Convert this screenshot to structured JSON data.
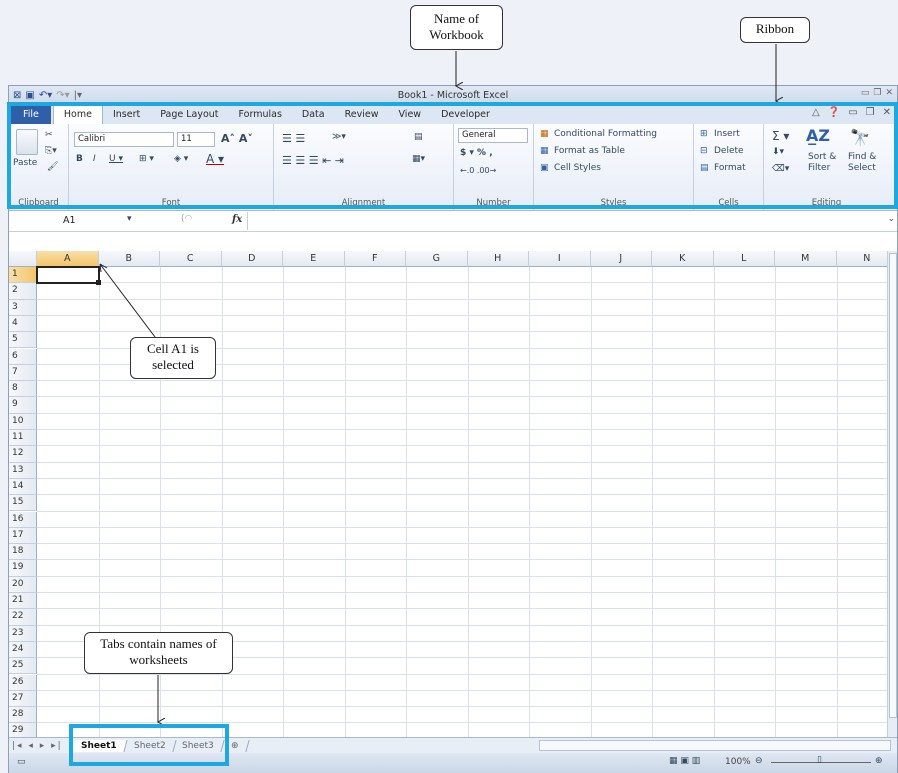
{
  "window": {
    "title": "Book1  -  Microsoft Excel"
  },
  "tabs": [
    "File",
    "Home",
    "Insert",
    "Page Layout",
    "Formulas",
    "Data",
    "Review",
    "View",
    "Developer"
  ],
  "ribbon": {
    "clipboard": {
      "label": "Clipboard",
      "paste": "Paste"
    },
    "font": {
      "label": "Font",
      "font_name": "Calibri",
      "font_size": "11"
    },
    "alignment": {
      "label": "Alignment"
    },
    "number": {
      "label": "Number",
      "format": "General"
    },
    "styles": {
      "label": "Styles",
      "conditional": "Conditional Formatting",
      "format_table": "Format as Table",
      "cell_styles": "Cell Styles"
    },
    "cells": {
      "label": "Cells",
      "insert": "Insert",
      "delete": "Delete",
      "format": "Format"
    },
    "editing": {
      "label": "Editing",
      "sort": "Sort &",
      "sort2": "Filter",
      "find": "Find &",
      "find2": "Select"
    }
  },
  "formula_bar": {
    "name_box": "A1",
    "fx": "fx"
  },
  "columns": [
    "A",
    "B",
    "C",
    "D",
    "E",
    "F",
    "G",
    "H",
    "I",
    "J",
    "K",
    "L",
    "M",
    "N"
  ],
  "rows": [
    "1",
    "2",
    "3",
    "4",
    "5",
    "6",
    "7",
    "8",
    "9",
    "10",
    "11",
    "12",
    "13",
    "14",
    "15",
    "16",
    "17",
    "18",
    "19",
    "20",
    "21",
    "22",
    "23",
    "24",
    "25",
    "26",
    "27",
    "28",
    "29"
  ],
  "sheets": [
    "Sheet1",
    "Sheet2",
    "Sheet3"
  ],
  "status": {
    "zoom": "100%"
  },
  "callouts": {
    "workbook": "Name of Workbook",
    "ribbon": "Ribbon",
    "cell": "Cell A1 is selected",
    "tabs": "Tabs contain names of worksheets"
  }
}
